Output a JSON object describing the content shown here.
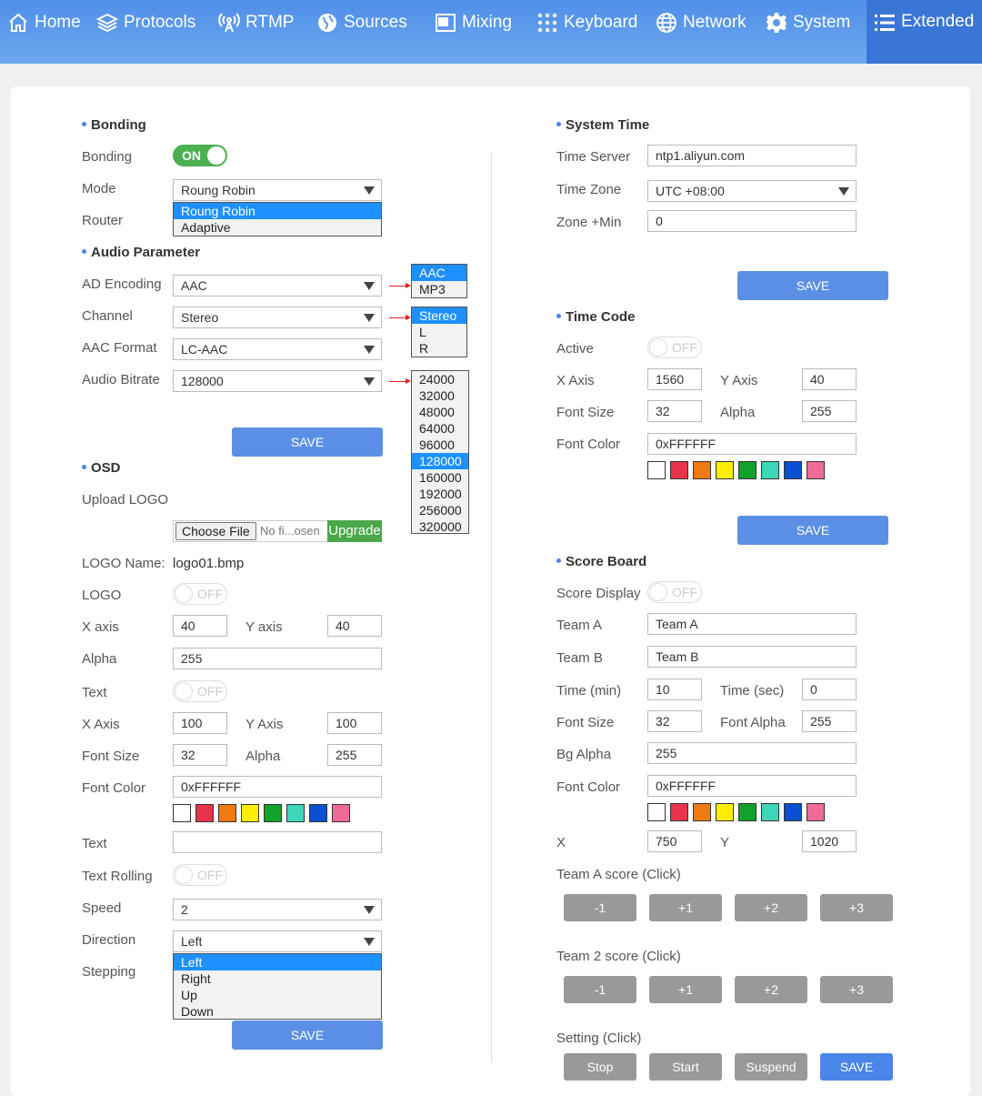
{
  "nav": {
    "items": [
      {
        "label": "Home",
        "icon": "home-icon"
      },
      {
        "label": "Protocols",
        "icon": "layers-icon"
      },
      {
        "label": "RTMP",
        "icon": "broadcast-icon"
      },
      {
        "label": "Sources",
        "icon": "globe-icon"
      },
      {
        "label": "Mixing",
        "icon": "mixing-icon"
      },
      {
        "label": "Keyboard",
        "icon": "keyboard-icon"
      },
      {
        "label": "Network",
        "icon": "network-icon"
      },
      {
        "label": "System",
        "icon": "gear-icon"
      },
      {
        "label": "Extended",
        "icon": "list-icon"
      }
    ],
    "active": "Extended"
  },
  "colors": {
    "nav": "#5a98ec",
    "accent": "#5b8fe6",
    "toggle_on": "#4caf50",
    "swatches": [
      "#ffffff",
      "#e8334a",
      "#f07a10",
      "#ffee00",
      "#12a22a",
      "#3ed6b8",
      "#0a4fd0",
      "#f06a98"
    ]
  },
  "bonding": {
    "title": "Bonding",
    "bonding_label": "Bonding",
    "bonding_state": "ON",
    "mode_label": "Mode",
    "mode_value": "Roung Robin",
    "mode_options": [
      "Roung Robin",
      "Adaptive"
    ],
    "router_label": "Router"
  },
  "audio": {
    "title": "Audio Parameter",
    "encoding_label": "AD Encoding",
    "encoding_value": "AAC",
    "encoding_options": [
      "AAC",
      "MP3"
    ],
    "channel_label": "Channel",
    "channel_value": "Stereo",
    "channel_options": [
      "Stereo",
      "L",
      "R"
    ],
    "format_label": "AAC Format",
    "format_value": "LC-AAC",
    "bitrate_label": "Audio Bitrate",
    "bitrate_value": "128000",
    "bitrate_options": [
      "24000",
      "32000",
      "48000",
      "64000",
      "96000",
      "128000",
      "160000",
      "192000",
      "256000",
      "320000"
    ],
    "save": "SAVE"
  },
  "osd": {
    "title": "OSD",
    "upload_label": "Upload LOGO",
    "choose_file": "Choose File",
    "file_text": "No fi...osen",
    "upgrade": "Upgrade",
    "logo_name_label": "LOGO Name:",
    "logo_name_value": "logo01.bmp",
    "logo_label": "LOGO",
    "logo_state": "OFF",
    "x_label": "X axis",
    "x_value": "40",
    "y_label": "Y axis",
    "y_value": "40",
    "alpha_label": "Alpha",
    "alpha_value": "255",
    "text_label": "Text",
    "text_state": "OFF",
    "tx_label": "X Axis",
    "tx_value": "100",
    "ty_label": "Y Axis",
    "ty_value": "100",
    "font_size_label": "Font Size",
    "font_size_value": "32",
    "talpha_label": "Alpha",
    "talpha_value": "255",
    "font_color_label": "Font Color",
    "font_color_value": "0xFFFFFF",
    "text2_label": "Text",
    "text2_value": "",
    "rolling_label": "Text Rolling",
    "rolling_state": "OFF",
    "speed_label": "Speed",
    "speed_value": "2",
    "direction_label": "Direction",
    "direction_value": "Left",
    "direction_options": [
      "Left",
      "Right",
      "Up",
      "Down"
    ],
    "stepping_label": "Stepping",
    "save": "SAVE"
  },
  "system_time": {
    "title": "System Time",
    "server_label": "Time Server",
    "server_value": "ntp1.aliyun.com",
    "zone_label": "Time Zone",
    "zone_value": "UTC +08:00",
    "min_label": "Zone +Min",
    "min_value": "0",
    "save": "SAVE"
  },
  "time_code": {
    "title": "Time Code",
    "active_label": "Active",
    "active_state": "OFF",
    "x_label": "X Axis",
    "x_value": "1560",
    "y_label": "Y Axis",
    "y_value": "40",
    "font_size_label": "Font Size",
    "font_size_value": "32",
    "alpha_label": "Alpha",
    "alpha_value": "255",
    "font_color_label": "Font Color",
    "font_color_value": "0xFFFFFF",
    "save": "SAVE"
  },
  "score_board": {
    "title": "Score Board",
    "display_label": "Score Display",
    "display_state": "OFF",
    "team_a_label": "Team A",
    "team_a_value": "Team A",
    "team_b_label": "Team B",
    "team_b_value": "Team B",
    "time_min_label": "Time (min)",
    "time_min_value": "10",
    "time_sec_label": "Time (sec)",
    "time_sec_value": "0",
    "font_size_label": "Font Size",
    "font_size_value": "32",
    "font_alpha_label": "Font Alpha",
    "font_alpha_value": "255",
    "bg_alpha_label": "Bg Alpha",
    "bg_alpha_value": "255",
    "font_color_label": "Font Color",
    "font_color_value": "0xFFFFFF",
    "x_label": "X",
    "x_value": "750",
    "y_label": "Y",
    "y_value": "1020",
    "team_a_score_label": "Team A score (Click)",
    "team_2_score_label": "Team 2 score (Click)",
    "score_buttons": [
      "-1",
      "+1",
      "+2",
      "+3"
    ],
    "setting_label": "Setting (Click)",
    "setting_buttons": [
      "Stop",
      "Start",
      "Suspend"
    ],
    "save": "SAVE"
  }
}
